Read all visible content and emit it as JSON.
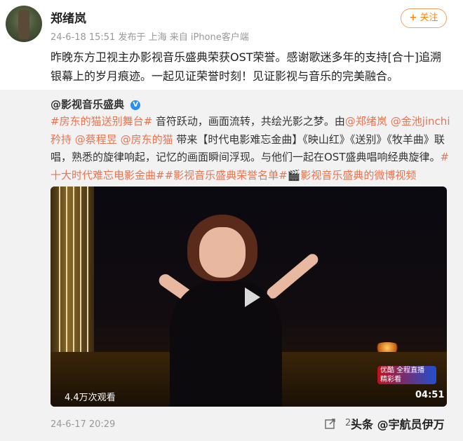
{
  "post": {
    "author": "郑绪岚",
    "meta": "24-6-18 15:51  发布于 上海  来自 iPhone客户端",
    "follow_label": "关注",
    "text": "昨晚东方卫视主办影视音乐盛典荣获OST荣誉。感谢歌迷多年的支持[合十]追溯银幕上的岁月痕迹。一起见证荣誉时刻！见证影视与音乐的完美融合。"
  },
  "repost": {
    "author": "@影视音乐盛典",
    "text_parts": [
      {
        "t": "#房东的猫送别舞台#",
        "link": true
      },
      {
        "t": " 音符跃动，画面流转，共绘光影之梦。由",
        "link": false
      },
      {
        "t": "@郑绪岚",
        "link": true
      },
      {
        "t": " ",
        "link": false
      },
      {
        "t": "@金池jinchi",
        "link": true
      },
      {
        "t": "矜持",
        "link": true
      },
      {
        "t": " ",
        "link": false
      },
      {
        "t": "@蔡程昱",
        "link": true
      },
      {
        "t": " ",
        "link": false
      },
      {
        "t": "@房东的猫",
        "link": true
      },
      {
        "t": " 带来【时代电影难忘金曲】《映山红》《送别》《牧羊曲》联唱，熟悉的旋律响起，记忆的画面瞬间浮现。与他们一起在OST盛典唱响经典旋律。",
        "link": false
      },
      {
        "t": "#十大时代难忘电影金曲#",
        "link": true
      },
      {
        "t": "#影视音乐盛典荣誉名单#",
        "link": true
      },
      {
        "t": "🎬影视音乐盛典的微博视频",
        "link": true
      }
    ],
    "video": {
      "views": "4.4万次观看",
      "duration": "04:51",
      "logo_text": "优酷 全程直播 精彩看"
    },
    "time": "24-6-17 20:29",
    "share_count": "21",
    "watermark": "头条 @宇航员伊万"
  }
}
